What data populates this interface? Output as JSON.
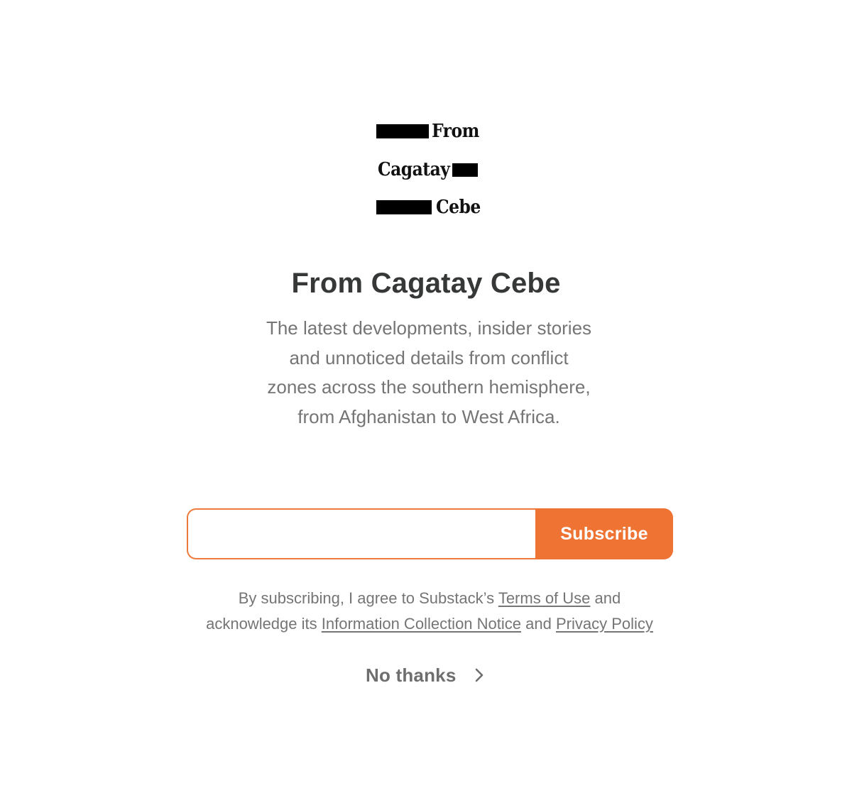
{
  "logo": {
    "line1": "From",
    "line2": "Cagatay",
    "line3": "Cebe"
  },
  "publication": {
    "title": "From Cagatay Cebe",
    "description_lines": [
      "The latest developments, insider stories",
      "and unnoticed details from conflict",
      "zones across the southern hemisphere,",
      "from Afghanistan to West Africa."
    ]
  },
  "subscribe": {
    "email_value": "",
    "email_placeholder": "",
    "button_label": "Subscribe"
  },
  "terms": {
    "prefix": "By subscribing, I agree to Substack’s",
    "terms_link": "Terms of Use",
    "and1": "and",
    "acknowledge": "acknowledge its",
    "notice_link": "Information Collection Notice",
    "and2": "and",
    "privacy_link": "Privacy Policy"
  },
  "no_thanks": {
    "label": "No thanks",
    "icon": "chevron-right-icon"
  },
  "colors": {
    "accent": "#ef7434",
    "title_text": "#363737",
    "body_text": "#757575"
  }
}
